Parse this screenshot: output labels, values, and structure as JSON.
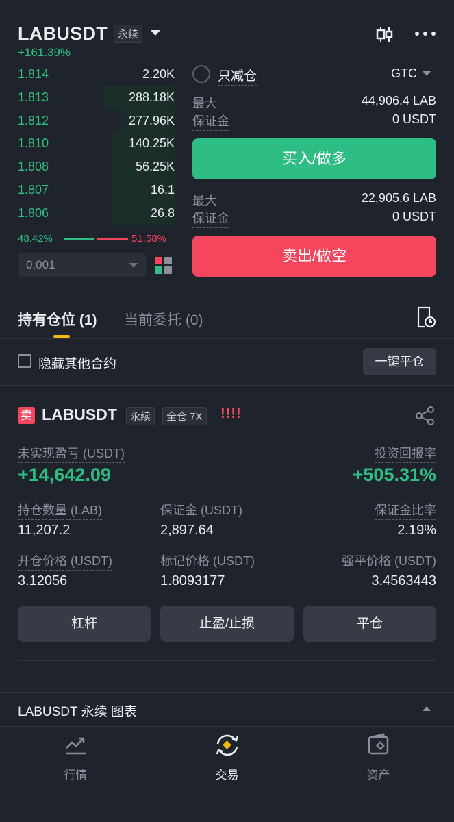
{
  "header": {
    "symbol": "LABUSDT",
    "contract_tag": "永续",
    "change": "+161.39%"
  },
  "orderbook": {
    "rows": [
      {
        "price": "1.814",
        "qty": "2.20K",
        "depth": 0.0
      },
      {
        "price": "1.813",
        "qty": "288.18K",
        "depth": 0.45
      },
      {
        "price": "1.812",
        "qty": "277.96K",
        "depth": 0.34
      },
      {
        "price": "1.810",
        "qty": "140.25K",
        "depth": 0.4
      },
      {
        "price": "1.808",
        "qty": "56.25K",
        "depth": 0.4
      },
      {
        "price": "1.807",
        "qty": "16.1",
        "depth": 0.4
      },
      {
        "price": "1.806",
        "qty": "26.8",
        "depth": 0.4
      }
    ],
    "buy_ratio": "48.42%",
    "sell_ratio": "51.58%",
    "precision": "0.001"
  },
  "order_form": {
    "reduce_only": "只减仓",
    "time_in_force": "GTC",
    "buy": {
      "max_label": "最大",
      "max_value": "44,906.4 LAB",
      "margin_label": "保证金",
      "margin_value": "0 USDT",
      "button": "买入/做多"
    },
    "sell": {
      "max_label": "最大",
      "max_value": "22,905.6 LAB",
      "margin_label": "保证金",
      "margin_value": "0 USDT",
      "button": "卖出/做空"
    }
  },
  "tabs": {
    "positions": "持有仓位 (1)",
    "orders": "当前委托 (0)"
  },
  "filters": {
    "hide_other": "隐藏其他合约",
    "close_all": "一键平仓"
  },
  "position": {
    "side_badge": "卖",
    "symbol": "LABUSDT",
    "tag_perpetual": "永续",
    "tag_margin": "全仓 7X",
    "warning": "!!!!",
    "unrealized_label": "未实现盈亏 (USDT)",
    "unrealized_value": "+14,642.09",
    "roe_label": "投资回报率",
    "roe_value": "+505.31%",
    "size_label": "持仓数量 (LAB)",
    "size_value": "11,207.2",
    "margin_label": "保证金 (USDT)",
    "margin_value": "2,897.64",
    "margin_ratio_label": "保证金比率",
    "margin_ratio_value": "2.19%",
    "entry_label": "开仓价格 (USDT)",
    "entry_value": "3.12056",
    "mark_label": "标记价格 (USDT)",
    "mark_value": "1.8093177",
    "liq_label": "强平价格 (USDT)",
    "liq_value": "3.4563443",
    "buttons": {
      "leverage": "杠杆",
      "tpsl": "止盈/止损",
      "close": "平仓"
    }
  },
  "chart_section": {
    "title": "LABUSDT 永续 图表"
  },
  "bottom_nav": {
    "market": "行情",
    "trade": "交易",
    "assets": "资产"
  },
  "colors": {
    "green": "#2ebd85",
    "red": "#f6465d",
    "accent": "#f0b90b",
    "background": "#1f232b"
  }
}
